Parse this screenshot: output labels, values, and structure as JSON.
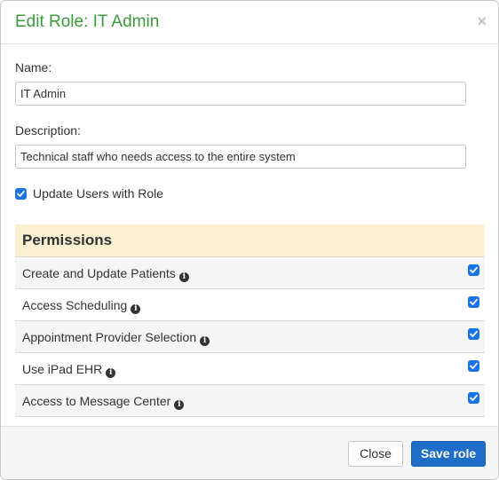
{
  "modal": {
    "title": "Edit Role: IT Admin",
    "close_symbol": "×"
  },
  "form": {
    "name_label": "Name:",
    "name_value": "IT Admin",
    "description_label": "Description:",
    "description_value": "Technical staff who needs access to the entire system",
    "update_users_label": "Update Users with Role",
    "update_users_checked": true
  },
  "permissions": {
    "header": "Permissions",
    "items": [
      {
        "label": "Create and Update Patients",
        "checked": true
      },
      {
        "label": "Access Scheduling",
        "checked": true
      },
      {
        "label": "Appointment Provider Selection",
        "checked": true
      },
      {
        "label": "Use iPad EHR",
        "checked": true
      },
      {
        "label": "Access to Message Center",
        "checked": true
      }
    ]
  },
  "footer": {
    "close_label": "Close",
    "save_label": "Save role"
  },
  "icons": {
    "info": "info-circle-icon",
    "check": "checkmark-icon",
    "close": "close-icon"
  },
  "colors": {
    "title_green": "#3c9a3c",
    "checkbox_blue": "#1a73e8",
    "save_blue": "#1e6ec8",
    "permissions_header_bg": "#fcf0d2"
  }
}
